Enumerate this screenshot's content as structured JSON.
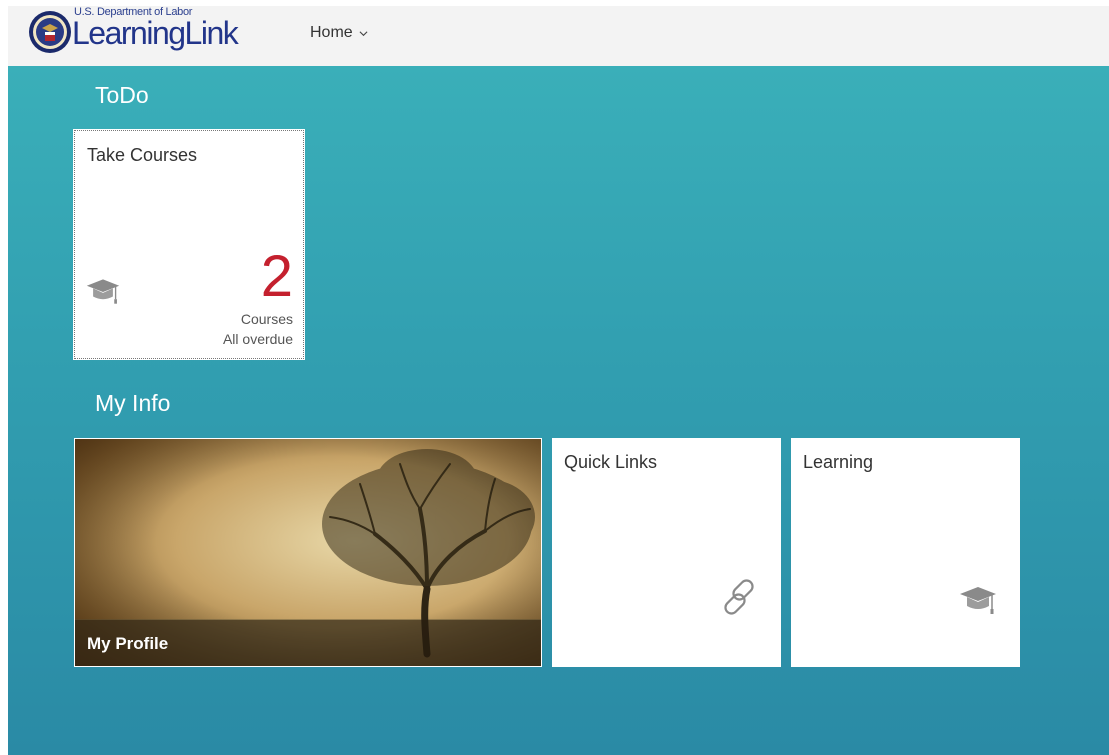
{
  "header": {
    "logo_small": "U.S. Department of Labor",
    "logo_big": "LearningLink",
    "nav_home": "Home"
  },
  "sections": {
    "todo_title": "ToDo",
    "myinfo_title": "My Info"
  },
  "tiles": {
    "take_courses": {
      "title": "Take Courses",
      "count": "2",
      "unit": "Courses",
      "note": "All overdue",
      "icon": "graduation-cap-icon"
    },
    "my_profile": {
      "label": "My Profile"
    },
    "quick_links": {
      "title": "Quick Links",
      "icon": "link-icon"
    },
    "learning": {
      "title": "Learning",
      "icon": "graduation-cap-icon"
    }
  },
  "colors": {
    "gradient_top": "#3aafb9",
    "gradient_bottom": "#2a8aa5",
    "count_red": "#c4202e",
    "logo_blue": "#22358a"
  }
}
